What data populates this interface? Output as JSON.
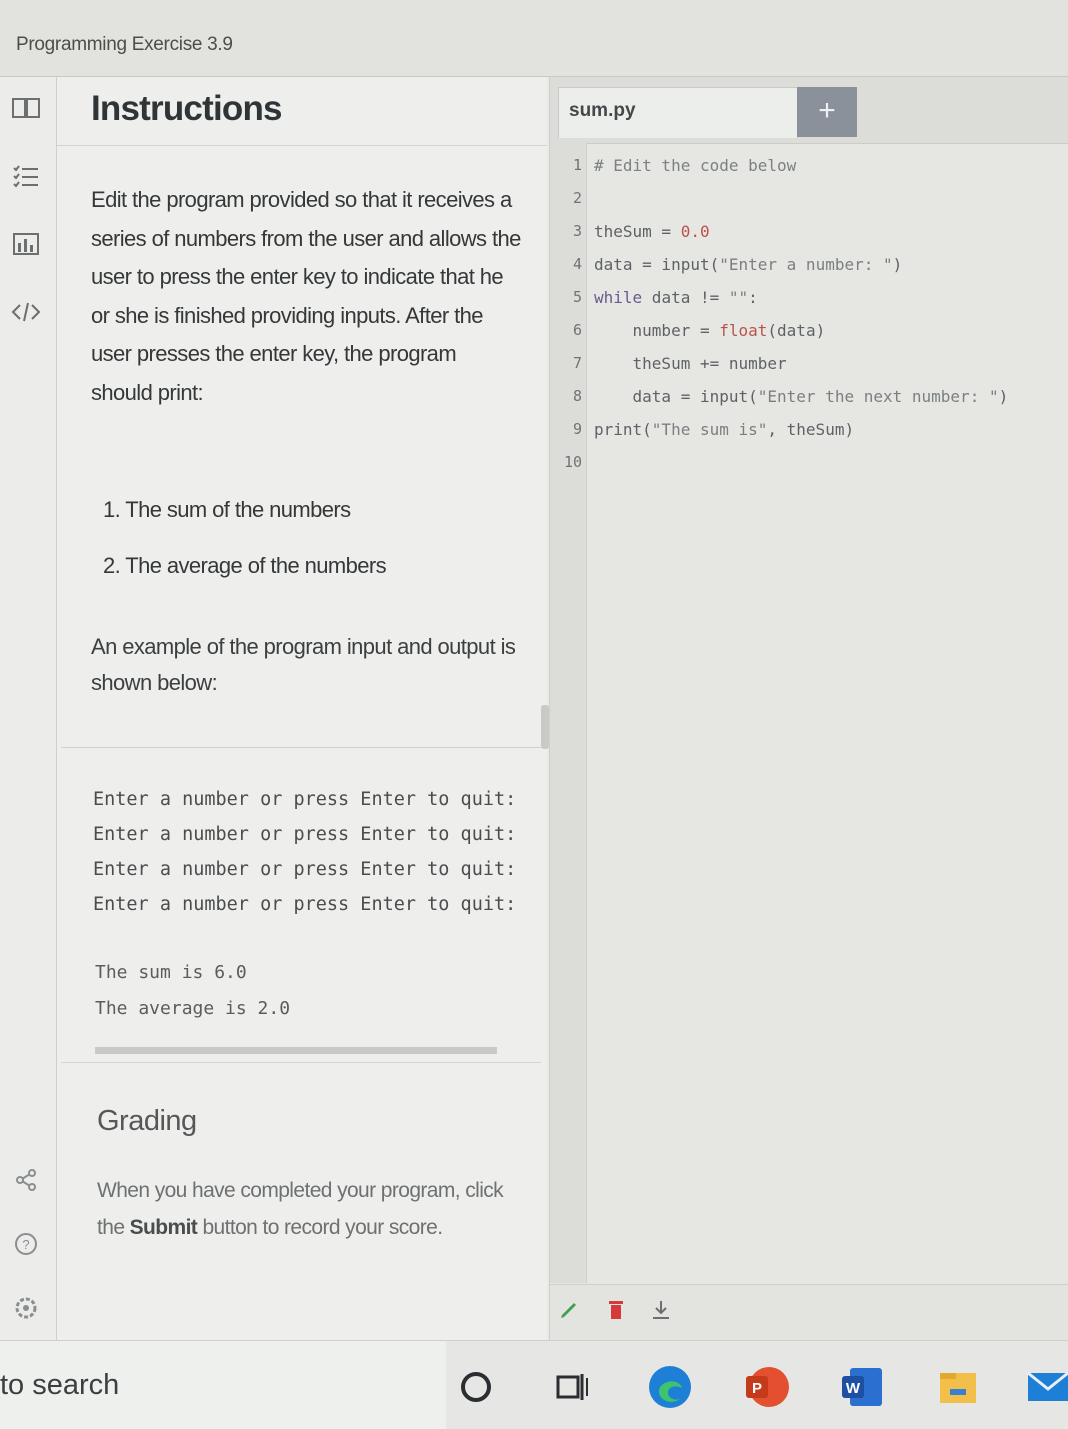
{
  "window": {
    "title": "Programming Exercise 3.9"
  },
  "instructions": {
    "header": "Instructions",
    "body": "Edit the program provided so that it receives a series of numbers from the user and allows the user to press the enter key to indicate that he or she is finished providing inputs. After the user presses the enter key, the program should print:",
    "list": [
      "1. The sum of the numbers",
      "2. The average of the numbers"
    ],
    "example_intro": "An example of the program input and output is shown below:",
    "sample_lines": [
      "Enter a number or press Enter to quit:",
      "Enter a number or press Enter to quit:",
      "Enter a number or press Enter to quit:",
      "Enter a number or press Enter to quit:"
    ],
    "sample_results": [
      "The sum is 6.0",
      "The average is 2.0"
    ],
    "grading_title": "Grading",
    "grading_pre": "When you have completed your program, click the ",
    "grading_bold": "Submit",
    "grading_post": " button to record your score."
  },
  "editor": {
    "tab_name": "sum.py",
    "add_tab": "+",
    "line_numbers": [
      "1",
      "2",
      "3",
      "4",
      "5",
      "6",
      "7",
      "8",
      "9",
      "10"
    ],
    "code": {
      "l1": "# Edit the code below",
      "l3_a": "theSum = ",
      "l3_b": "0.0",
      "l4_a": "data = input(",
      "l4_b": "\"Enter a number: \"",
      "l4_c": ")",
      "l5_a": "while",
      "l5_b": " data != ",
      "l5_c": "\"\"",
      "l5_d": ":",
      "l6_a": "    number = ",
      "l6_b": "float",
      "l6_c": "(data)",
      "l7": "    theSum += number",
      "l8_a": "    data = input(",
      "l8_b": "\"Enter the next number: \"",
      "l8_c": ")",
      "l9_a": "print(",
      "l9_b": "\"The sum is\"",
      "l9_c": ", theSum)"
    }
  },
  "taskbar": {
    "search_text": "to search"
  },
  "colors": {
    "accent_green": "#3ea04a",
    "trash_red": "#d63a3a",
    "edge_blue": "#1e7fd6"
  }
}
